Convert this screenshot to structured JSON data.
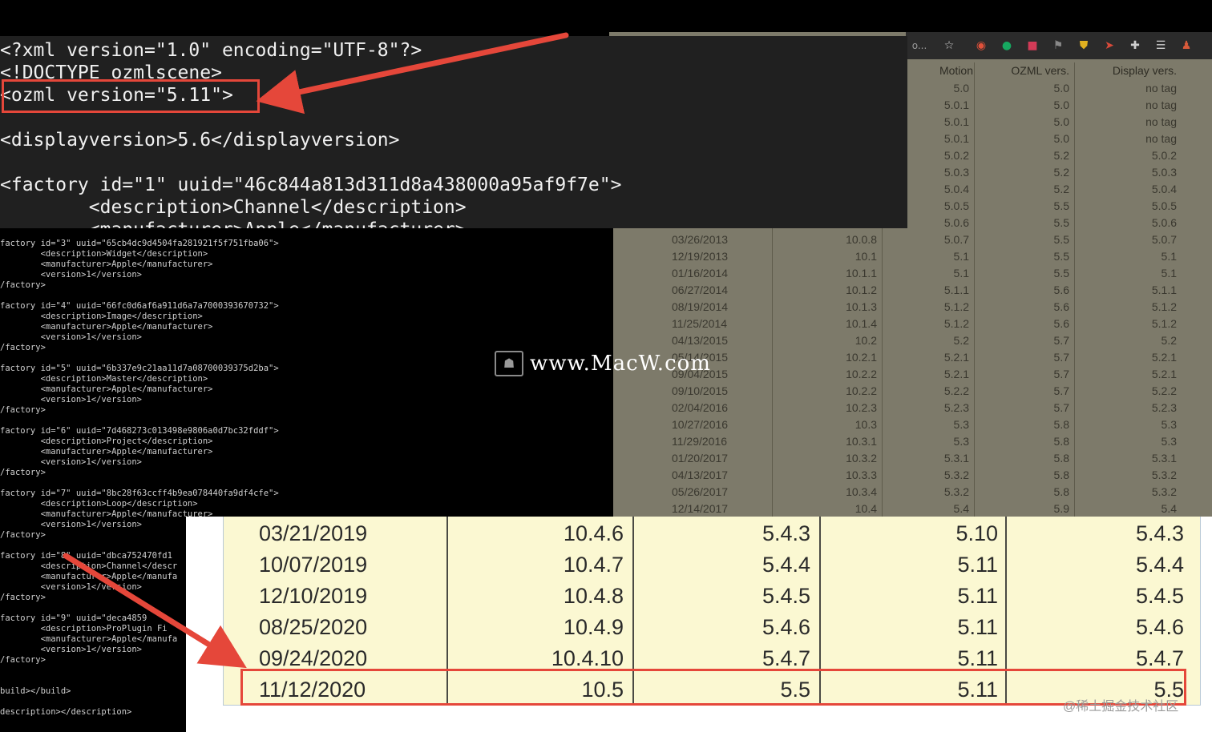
{
  "colors": {
    "accent": "#e5473a",
    "table_bg": "#fbf8d2",
    "panel_bg": "#202020"
  },
  "toolbar_icons": [
    "star-icon",
    "extension-icon",
    "grammarly-icon",
    "extension-icon",
    "extension-icon",
    "shield-icon",
    "arrow-icon",
    "puzzle-icon",
    "list-icon",
    "avatar-icon"
  ],
  "toolbar_partial_text": "o...",
  "bg_table": {
    "headers": [
      "Motion",
      "OZML vers.",
      "Display vers."
    ],
    "top_rows": [
      [
        "5.0",
        "5.0",
        "no tag"
      ],
      [
        "5.0.1",
        "5.0",
        "no tag"
      ],
      [
        "5.0.1",
        "5.0",
        "no tag"
      ],
      [
        "5.0.1",
        "5.0",
        "no tag"
      ],
      [
        "5.0.2",
        "5.2",
        "5.0.2"
      ],
      [
        "5.0.3",
        "5.2",
        "5.0.3"
      ],
      [
        "5.0.4",
        "5.2",
        "5.0.4"
      ],
      [
        "5.0.5",
        "5.5",
        "5.0.5"
      ],
      [
        "5.0.6",
        "5.5",
        "5.0.6"
      ]
    ],
    "rows": [
      [
        "03/26/2013",
        "10.0.8",
        "5.0.7",
        "5.5",
        "5.0.7"
      ],
      [
        "12/19/2013",
        "10.1",
        "5.1",
        "5.5",
        "5.1"
      ],
      [
        "01/16/2014",
        "10.1.1",
        "5.1",
        "5.5",
        "5.1"
      ],
      [
        "06/27/2014",
        "10.1.2",
        "5.1.1",
        "5.6",
        "5.1.1"
      ],
      [
        "08/19/2014",
        "10.1.3",
        "5.1.2",
        "5.6",
        "5.1.2"
      ],
      [
        "11/25/2014",
        "10.1.4",
        "5.1.2",
        "5.6",
        "5.1.2"
      ],
      [
        "04/13/2015",
        "10.2",
        "5.2",
        "5.7",
        "5.2"
      ],
      [
        "05/14/2015",
        "10.2.1",
        "5.2.1",
        "5.7",
        "5.2.1"
      ],
      [
        "09/04/2015",
        "10.2.2",
        "5.2.1",
        "5.7",
        "5.2.1"
      ],
      [
        "09/10/2015",
        "10.2.2",
        "5.2.2",
        "5.7",
        "5.2.2"
      ],
      [
        "02/04/2016",
        "10.2.3",
        "5.2.3",
        "5.7",
        "5.2.3"
      ],
      [
        "10/27/2016",
        "10.3",
        "5.3",
        "5.8",
        "5.3"
      ],
      [
        "11/29/2016",
        "10.3.1",
        "5.3",
        "5.8",
        "5.3"
      ],
      [
        "01/20/2017",
        "10.3.2",
        "5.3.1",
        "5.8",
        "5.3.1"
      ],
      [
        "04/13/2017",
        "10.3.3",
        "5.3.2",
        "5.8",
        "5.3.2"
      ],
      [
        "05/26/2017",
        "10.3.4",
        "5.3.2",
        "5.8",
        "5.3.2"
      ],
      [
        "12/14/2017",
        "10.4",
        "5.4",
        "5.9",
        "5.4"
      ]
    ]
  },
  "zoom_code": {
    "lines": [
      "<?xml version=\"1.0\" encoding=\"UTF-8\"?>",
      "<!DOCTYPE ozmlscene>",
      "<ozml version=\"5.11\">",
      "",
      "<displayversion>5.6</displayversion>",
      "",
      "<factory id=\"1\" uuid=\"46c844a813d311d8a438000a95af9f7e\">",
      "        <description>Channel</description>",
      "        <manufacturer>Apple</manufacturer>"
    ]
  },
  "small_code": {
    "lines": [
      "factory id=\"3\" uuid=\"65cb4dc9d4504fa281921f5f751fba06\">",
      "        <description>Widget</description>",
      "        <manufacturer>Apple</manufacturer>",
      "        <version>1</version>",
      "/factory>",
      "",
      "factory id=\"4\" uuid=\"66fc0d6af6a911d6a7a7000393670732\">",
      "        <description>Image</description>",
      "        <manufacturer>Apple</manufacturer>",
      "        <version>1</version>",
      "/factory>",
      "",
      "factory id=\"5\" uuid=\"6b337e9c21aa11d7a08700039375d2ba\">",
      "        <description>Master</description>",
      "        <manufacturer>Apple</manufacturer>",
      "        <version>1</version>",
      "/factory>",
      "",
      "factory id=\"6\" uuid=\"7d468273c013498e9806a0d7bc32fddf\">",
      "        <description>Project</description>",
      "        <manufacturer>Apple</manufacturer>",
      "        <version>1</version>",
      "/factory>",
      "",
      "factory id=\"7\" uuid=\"8bc28f63ccff4b9ea078440fa9df4cfe\">",
      "        <description>Loop</description>",
      "        <manufacturer>Apple</manufacturer>",
      "        <version>1</version>",
      "/factory>",
      "",
      "factory id=\"8\" uuid=\"dbca752470fd1",
      "        <description>Channel</descr",
      "        <manufacturer>Apple</manufa",
      "        <version>1</version>",
      "/factory>",
      "",
      "factory id=\"9\" uuid=\"deca4859",
      "        <description>ProPlugin Fi",
      "        <manufacturer>Apple</manufa",
      "        <version>1</version>",
      "/factory>",
      "",
      "",
      "build></build>",
      "",
      "description></description>"
    ]
  },
  "watermark": {
    "logo_glyph": "☗",
    "text": "www.MacW.com"
  },
  "bottom_table": {
    "rows": [
      [
        "03/21/2019",
        "10.4.6",
        "5.4.3",
        "5.10",
        "5.4.3"
      ],
      [
        "10/07/2019",
        "10.4.7",
        "5.4.4",
        "5.11",
        "5.4.4"
      ],
      [
        "12/10/2019",
        "10.4.8",
        "5.4.5",
        "5.11",
        "5.4.5"
      ],
      [
        "08/25/2020",
        "10.4.9",
        "5.4.6",
        "5.11",
        "5.4.6"
      ],
      [
        "09/24/2020",
        "10.4.10",
        "5.4.7",
        "5.11",
        "5.4.7"
      ],
      [
        "11/12/2020",
        "10.5",
        "5.5",
        "5.11",
        "5.5"
      ]
    ],
    "watermark": "@稀土掘金技术社区"
  }
}
